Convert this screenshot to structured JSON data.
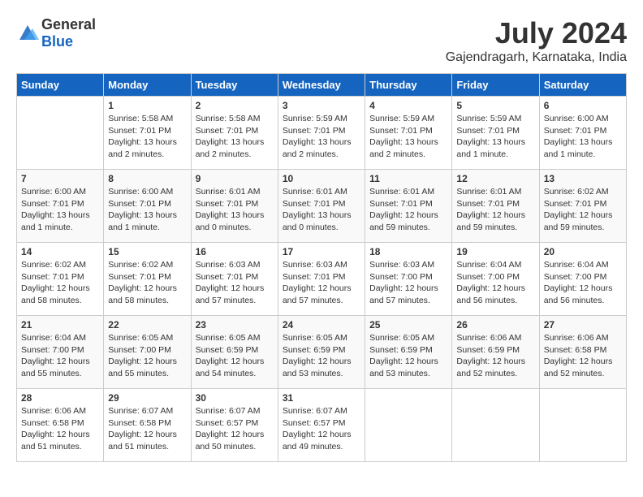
{
  "header": {
    "logo_general": "General",
    "logo_blue": "Blue",
    "month_year": "July 2024",
    "location": "Gajendragarh, Karnataka, India"
  },
  "days_of_week": [
    "Sunday",
    "Monday",
    "Tuesday",
    "Wednesday",
    "Thursday",
    "Friday",
    "Saturday"
  ],
  "weeks": [
    [
      {
        "day": "",
        "info": ""
      },
      {
        "day": "1",
        "info": "Sunrise: 5:58 AM\nSunset: 7:01 PM\nDaylight: 13 hours\nand 2 minutes."
      },
      {
        "day": "2",
        "info": "Sunrise: 5:58 AM\nSunset: 7:01 PM\nDaylight: 13 hours\nand 2 minutes."
      },
      {
        "day": "3",
        "info": "Sunrise: 5:59 AM\nSunset: 7:01 PM\nDaylight: 13 hours\nand 2 minutes."
      },
      {
        "day": "4",
        "info": "Sunrise: 5:59 AM\nSunset: 7:01 PM\nDaylight: 13 hours\nand 2 minutes."
      },
      {
        "day": "5",
        "info": "Sunrise: 5:59 AM\nSunset: 7:01 PM\nDaylight: 13 hours\nand 1 minute."
      },
      {
        "day": "6",
        "info": "Sunrise: 6:00 AM\nSunset: 7:01 PM\nDaylight: 13 hours\nand 1 minute."
      }
    ],
    [
      {
        "day": "7",
        "info": "Sunrise: 6:00 AM\nSunset: 7:01 PM\nDaylight: 13 hours\nand 1 minute."
      },
      {
        "day": "8",
        "info": "Sunrise: 6:00 AM\nSunset: 7:01 PM\nDaylight: 13 hours\nand 1 minute."
      },
      {
        "day": "9",
        "info": "Sunrise: 6:01 AM\nSunset: 7:01 PM\nDaylight: 13 hours\nand 0 minutes."
      },
      {
        "day": "10",
        "info": "Sunrise: 6:01 AM\nSunset: 7:01 PM\nDaylight: 13 hours\nand 0 minutes."
      },
      {
        "day": "11",
        "info": "Sunrise: 6:01 AM\nSunset: 7:01 PM\nDaylight: 12 hours\nand 59 minutes."
      },
      {
        "day": "12",
        "info": "Sunrise: 6:01 AM\nSunset: 7:01 PM\nDaylight: 12 hours\nand 59 minutes."
      },
      {
        "day": "13",
        "info": "Sunrise: 6:02 AM\nSunset: 7:01 PM\nDaylight: 12 hours\nand 59 minutes."
      }
    ],
    [
      {
        "day": "14",
        "info": "Sunrise: 6:02 AM\nSunset: 7:01 PM\nDaylight: 12 hours\nand 58 minutes."
      },
      {
        "day": "15",
        "info": "Sunrise: 6:02 AM\nSunset: 7:01 PM\nDaylight: 12 hours\nand 58 minutes."
      },
      {
        "day": "16",
        "info": "Sunrise: 6:03 AM\nSunset: 7:01 PM\nDaylight: 12 hours\nand 57 minutes."
      },
      {
        "day": "17",
        "info": "Sunrise: 6:03 AM\nSunset: 7:01 PM\nDaylight: 12 hours\nand 57 minutes."
      },
      {
        "day": "18",
        "info": "Sunrise: 6:03 AM\nSunset: 7:00 PM\nDaylight: 12 hours\nand 57 minutes."
      },
      {
        "day": "19",
        "info": "Sunrise: 6:04 AM\nSunset: 7:00 PM\nDaylight: 12 hours\nand 56 minutes."
      },
      {
        "day": "20",
        "info": "Sunrise: 6:04 AM\nSunset: 7:00 PM\nDaylight: 12 hours\nand 56 minutes."
      }
    ],
    [
      {
        "day": "21",
        "info": "Sunrise: 6:04 AM\nSunset: 7:00 PM\nDaylight: 12 hours\nand 55 minutes."
      },
      {
        "day": "22",
        "info": "Sunrise: 6:05 AM\nSunset: 7:00 PM\nDaylight: 12 hours\nand 55 minutes."
      },
      {
        "day": "23",
        "info": "Sunrise: 6:05 AM\nSunset: 6:59 PM\nDaylight: 12 hours\nand 54 minutes."
      },
      {
        "day": "24",
        "info": "Sunrise: 6:05 AM\nSunset: 6:59 PM\nDaylight: 12 hours\nand 53 minutes."
      },
      {
        "day": "25",
        "info": "Sunrise: 6:05 AM\nSunset: 6:59 PM\nDaylight: 12 hours\nand 53 minutes."
      },
      {
        "day": "26",
        "info": "Sunrise: 6:06 AM\nSunset: 6:59 PM\nDaylight: 12 hours\nand 52 minutes."
      },
      {
        "day": "27",
        "info": "Sunrise: 6:06 AM\nSunset: 6:58 PM\nDaylight: 12 hours\nand 52 minutes."
      }
    ],
    [
      {
        "day": "28",
        "info": "Sunrise: 6:06 AM\nSunset: 6:58 PM\nDaylight: 12 hours\nand 51 minutes."
      },
      {
        "day": "29",
        "info": "Sunrise: 6:07 AM\nSunset: 6:58 PM\nDaylight: 12 hours\nand 51 minutes."
      },
      {
        "day": "30",
        "info": "Sunrise: 6:07 AM\nSunset: 6:57 PM\nDaylight: 12 hours\nand 50 minutes."
      },
      {
        "day": "31",
        "info": "Sunrise: 6:07 AM\nSunset: 6:57 PM\nDaylight: 12 hours\nand 49 minutes."
      },
      {
        "day": "",
        "info": ""
      },
      {
        "day": "",
        "info": ""
      },
      {
        "day": "",
        "info": ""
      }
    ]
  ]
}
